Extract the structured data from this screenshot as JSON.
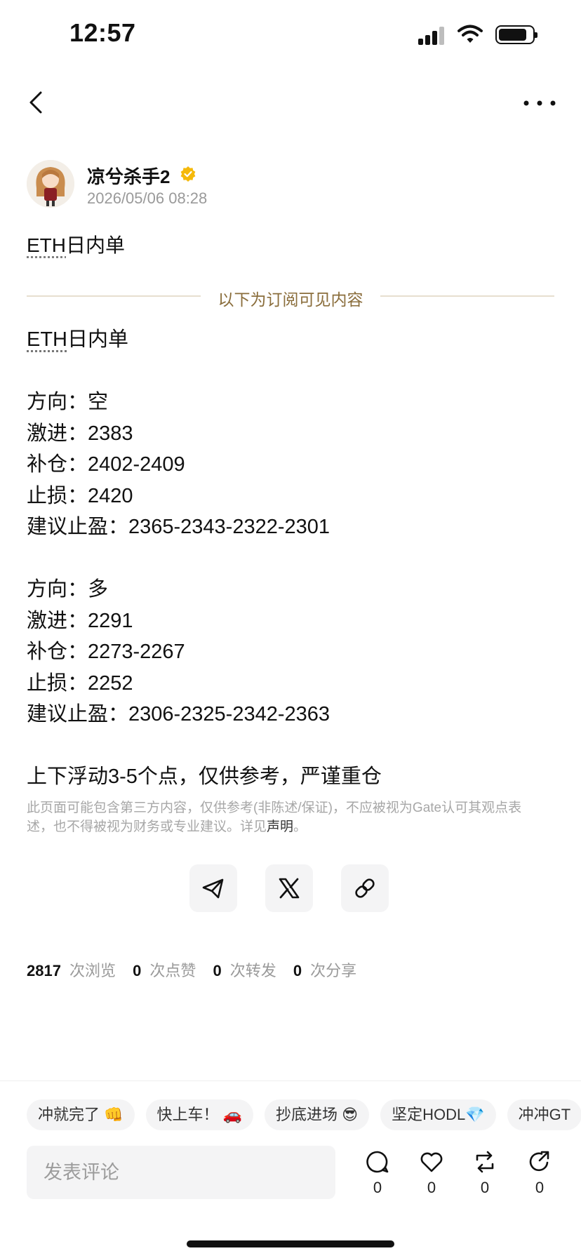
{
  "status_bar": {
    "time": "12:57"
  },
  "icons": {
    "back": "chevron-left-icon",
    "more": "more-horizontal-icon",
    "verified": "verified-badge-icon",
    "share_telegram": "telegram-icon",
    "share_x": "x-logo-icon",
    "share_link": "link-icon",
    "comment": "comment-icon",
    "like": "heart-icon",
    "repost": "repost-icon",
    "share": "share-icon"
  },
  "colors": {
    "divider_label": "#8a6d3b",
    "verified": "#f5b90a",
    "muted": "#9a9a9a"
  },
  "author": {
    "name": "凉兮杀手2",
    "time": "2026/05/06 08:28"
  },
  "post": {
    "title_prefix": "ETH",
    "title_rest": "日内单",
    "divider_label": "以下为订阅可见内容",
    "body_title_prefix": "ETH",
    "body_title_rest": "日内单",
    "block1": [
      "方向：空",
      "激进：2383",
      "补仓：2402-2409",
      "止损：2420",
      "建议止盈：2365-2343-2322-2301"
    ],
    "block2": [
      "方向：多",
      "激进：2291",
      "补仓：2273-2267",
      "止损：2252",
      "建议止盈：2306-2325-2342-2363"
    ],
    "note": "上下浮动3-5个点，仅供参考，严谨重仓"
  },
  "disclaimer": {
    "text": "此页面可能包含第三方内容，仅供参考(非陈述/保证)，不应被视为Gate认可其观点表述，也不得被视为财务或专业建议。详见",
    "link": "声明",
    "end": "。"
  },
  "stats": {
    "views": "2817",
    "views_label": "次浏览",
    "likes": "0",
    "likes_label": "次点赞",
    "reposts": "0",
    "reposts_label": "次转发",
    "shares": "0",
    "shares_label": "次分享"
  },
  "quick_replies": [
    "冲就完了 👊",
    "快上车！ 🚗",
    "抄底进场 😎",
    "坚定HODL💎",
    "冲冲GT"
  ],
  "comment": {
    "placeholder": "发表评论"
  },
  "actions": {
    "comments": "0",
    "likes": "0",
    "reposts": "0",
    "shares": "0"
  }
}
